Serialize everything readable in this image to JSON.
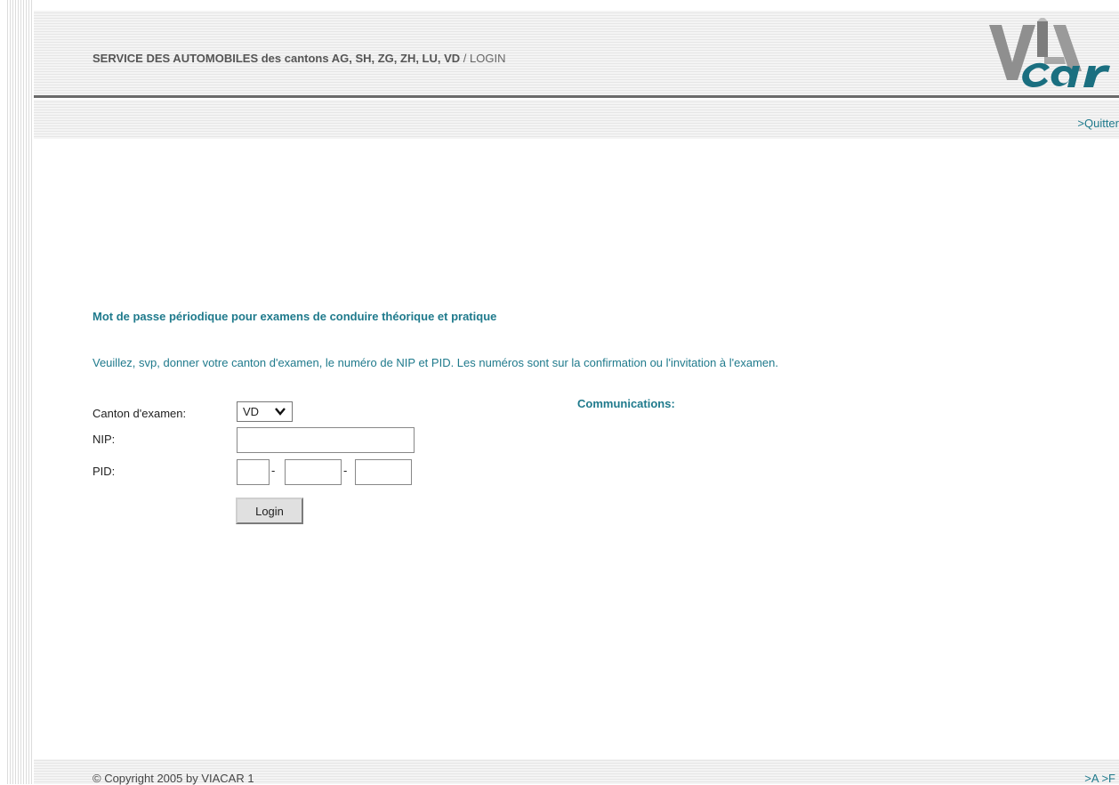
{
  "header": {
    "title": "SERVICE DES AUTOMOBILES des cantons  AG, SH, ZG, ZH, LU, VD",
    "crumb": " / LOGIN",
    "logo_text": "VIACAR",
    "quit_label": ">Quitter"
  },
  "main": {
    "heading": "Mot de passe périodique pour examens de conduire théorique et pratique",
    "instructions": "Veuillez, svp, donner votre canton d'examen, le numéro de NIP et PID. Les numéros sont sur la confirmation ou l'invitation à l'examen.",
    "form": {
      "canton_label": "Canton d'examen:",
      "canton_value": "VD",
      "nip_label": "NIP:",
      "nip_value": "",
      "pid_label": "PID:",
      "pid_separator": "-",
      "login_label": "Login"
    },
    "communications_label": "Communications:"
  },
  "footer": {
    "copyright": "© Copyright 2005 by VIACAR    1",
    "lang_a": ">A",
    "lang_f": ">F"
  },
  "colors": {
    "accent": "#1f7a8c",
    "rule": "#6a6a6a",
    "stripe": "#e6e6e6"
  }
}
